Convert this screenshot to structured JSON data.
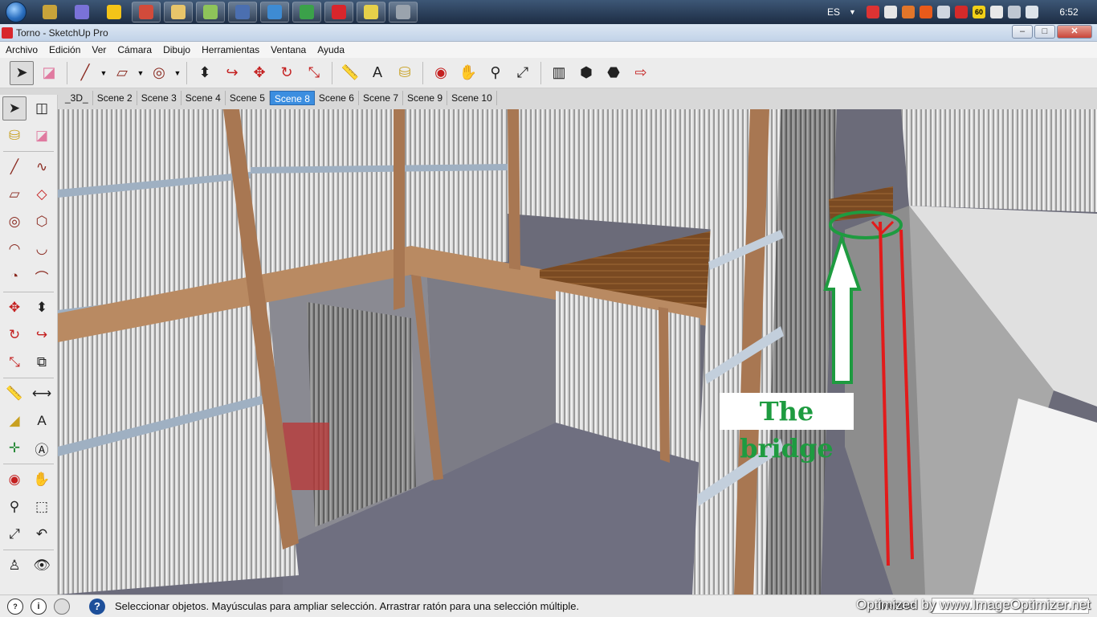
{
  "taskbar": {
    "language": "ES",
    "clock": "6:52",
    "tray_badge": "60",
    "apps": [
      {
        "icon": "hat-icon",
        "color": "#c8a33a"
      },
      {
        "icon": "lab-icon",
        "color": "#7a72d8"
      },
      {
        "icon": "n-app-icon",
        "color": "#f4c418"
      },
      {
        "icon": "chrome-icon",
        "color": "#d24b3b"
      },
      {
        "icon": "file-explorer-icon",
        "color": "#e8c56a"
      },
      {
        "icon": "chat-icon",
        "color": "#8ec45a"
      },
      {
        "icon": "remote-desktop-icon",
        "color": "#4b6fb0"
      },
      {
        "icon": "frame-app-icon",
        "color": "#3e8bd3"
      },
      {
        "icon": "chrome-icon",
        "color": "#3ba14a"
      },
      {
        "icon": "sketchup-icon",
        "color": "#d8262c"
      },
      {
        "icon": "notepad-icon",
        "color": "#e6d04a"
      },
      {
        "icon": "gamepad-icon",
        "color": "#9aa3ad"
      }
    ]
  },
  "window": {
    "title": "Torno - SketchUp Pro",
    "min": "–",
    "max": "□",
    "close": "✕"
  },
  "menu": [
    "Archivo",
    "Edición",
    "Ver",
    "Cámara",
    "Dibujo",
    "Herramientas",
    "Ventana",
    "Ayuda"
  ],
  "toolbar": [
    "select-icon",
    "eraser-icon",
    "line-icon",
    "rectangle-icon",
    "circle-icon",
    "push-pull-icon",
    "follow-me-icon",
    "move-icon",
    "rotate-icon",
    "scale-icon",
    "tape-measure-icon",
    "text-icon",
    "paint-bucket-icon",
    "orbit-icon",
    "pan-icon",
    "zoom-icon",
    "zoom-extents-icon",
    "3d-warehouse-icon",
    "components-icon",
    "extension-warehouse-icon",
    "send-to-layout-icon"
  ],
  "scenes": {
    "tabs": [
      "_3D_",
      "Scene 2",
      "Scene 3",
      "Scene 4",
      "Scene 5",
      "Scene 8",
      "Scene 6",
      "Scene 7",
      "Scene 9",
      "Scene 10"
    ],
    "active": "Scene 8"
  },
  "palette": [
    [
      "select-icon",
      "component-icon"
    ],
    [
      "paint-bucket-icon",
      "eraser-icon"
    ],
    [
      "line-icon",
      "freehand-icon"
    ],
    [
      "rectangle-icon",
      "rotated-rectangle-icon"
    ],
    [
      "circle-icon",
      "polygon-icon"
    ],
    [
      "arc-icon",
      "two-point-arc-icon"
    ],
    [
      "pie-icon",
      "three-point-arc-icon"
    ],
    [
      "move-icon",
      "push-pull-icon"
    ],
    [
      "rotate-icon",
      "follow-me-icon"
    ],
    [
      "scale-icon",
      "offset-icon"
    ],
    [
      "tape-measure-icon",
      "dimension-icon"
    ],
    [
      "protractor-icon",
      "text-icon"
    ],
    [
      "axes-icon",
      "3d-text-icon"
    ],
    [
      "orbit-icon",
      "pan-icon"
    ],
    [
      "zoom-icon",
      "zoom-window-icon"
    ],
    [
      "zoom-extents-icon",
      "previous-view-icon"
    ],
    [
      "walk-icon",
      "look-around-icon"
    ]
  ],
  "viewport": {
    "annotation": "The bridge",
    "accent": "#1e9b40",
    "marker_color": "#e21b1b"
  },
  "status": {
    "text": "Seleccionar objetos. Mayúsculas para ampliar selección. Arrastrar ratón para una selección múltiple.",
    "measure_label": "Medidas",
    "measure_value": "",
    "help": "?",
    "info": "i",
    "watermark": "Optimized by www.ImageOptimizer.net"
  }
}
